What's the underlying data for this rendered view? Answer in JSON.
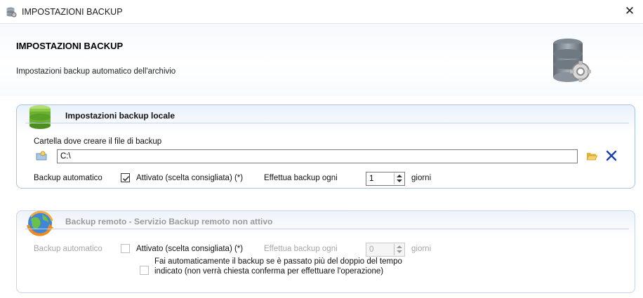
{
  "window": {
    "title": "IMPOSTAZIONI BACKUP",
    "close_glyph": "✕",
    "app_icon": "database-icon"
  },
  "header": {
    "title": "IMPOSTAZIONI BACKUP",
    "subtitle": "Impostazioni backup automatico dell'archivio",
    "icon": "database-gear-icon"
  },
  "local": {
    "title": "Impostazioni backup locale",
    "icon": "database-green-icon",
    "folder_label": "Cartella dove creare il file di backup",
    "folder_value": "C:\\",
    "auto_label": "Backup automatico",
    "enabled_checked": true,
    "enabled_label": "Attivato (scelta consigliata) (*)",
    "every_label": "Effettua backup ogni",
    "days_value": "1",
    "days_unit": "giorni",
    "accent_color": "#1c3fa8"
  },
  "remote": {
    "title": "Backup remoto - Servizio Backup remoto non attivo",
    "icon": "globe-sync-icon",
    "auto_label": "Backup automatico",
    "enabled_checked": false,
    "enabled_label": "Attivato (scelta consigliata) (*)",
    "every_label": "Effettua backup ogni",
    "days_value": "0",
    "days_unit": "giorni",
    "double_time_checked": false,
    "double_time_line1": "Fai automaticamente il backup se è passato più del doppio del tempo",
    "double_time_line2": "indicato (non verrà chiesta conferma per effettuare l'operazione)"
  }
}
